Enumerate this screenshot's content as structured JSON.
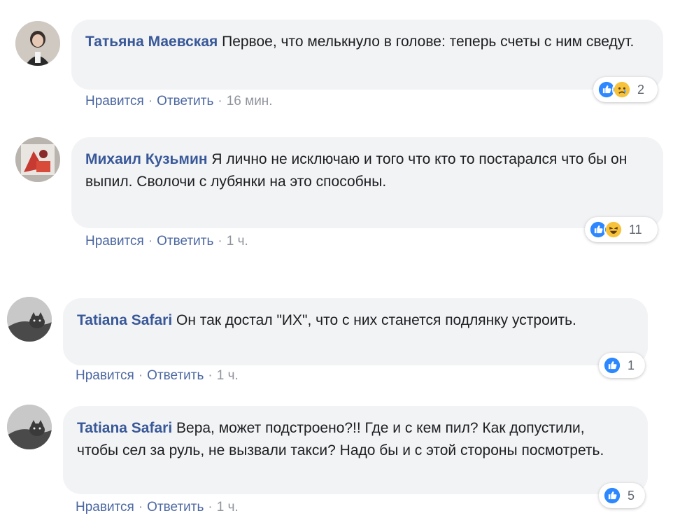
{
  "colors": {
    "author": "#385898",
    "bubble": "#f2f3f5",
    "link": "#4b67a1",
    "meta": "#90949c",
    "like": "#2d88ff",
    "emoji": "#f7c33c"
  },
  "comments": [
    {
      "author": "Татьяна Маевская",
      "text": "Первое, что мелькнуло в голове: теперь счеты с ним сведут.",
      "like_label": "Нравится",
      "reply_label": "Ответить",
      "time": "16 мин.",
      "reactions": [
        "like-icon",
        "sad-icon"
      ],
      "reaction_count": "2"
    },
    {
      "author": "Михаил Кузьмин",
      "text": "Я лично не исключаю и того что кто то постарался что бы он выпил. Сволочи с лубянки на это способны.",
      "like_label": "Нравится",
      "reply_label": "Ответить",
      "time": "1 ч.",
      "reactions": [
        "like-icon",
        "haha-icon"
      ],
      "reaction_count": "11"
    },
    {
      "author": "Tatiana Safari",
      "text": "Он так достал \"ИХ\", что с них станется подлянку устроить.",
      "like_label": "Нравится",
      "reply_label": "Ответить",
      "time": "1 ч.",
      "reactions": [
        "like-icon"
      ],
      "reaction_count": "1"
    },
    {
      "author": "Tatiana Safari",
      "text": "Вера, может подстроено?!! Где и с кем пил? Как допустили, чтобы сел за руль, не вызвали такси? Надо бы и с этой стороны посмотреть.",
      "like_label": "Нравится",
      "reply_label": "Ответить",
      "time": "1 ч.",
      "reactions": [
        "like-icon"
      ],
      "reaction_count": "5"
    }
  ]
}
